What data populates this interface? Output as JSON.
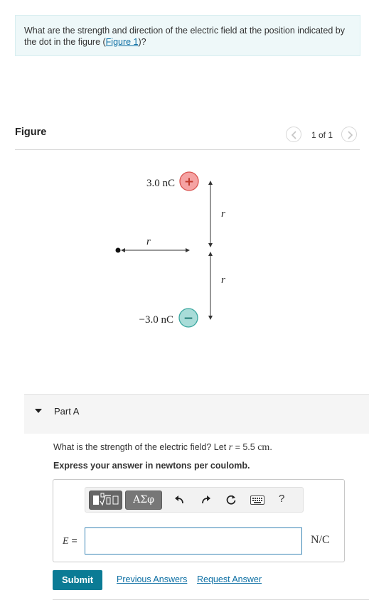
{
  "question": {
    "text_before": "What are the strength and direction of the electric field at the position indicated by the dot in the figure (",
    "link": "Figure 1",
    "text_after": ")?"
  },
  "figure": {
    "title": "Figure",
    "counter": "1 of 1",
    "diagram": {
      "positive_charge_label": "3.0 nC",
      "positive_symbol": "+",
      "negative_charge_label": "−3.0 nC",
      "negative_symbol": "−",
      "distance_symbol": "r"
    }
  },
  "part_a": {
    "label": "Part A",
    "prompt_before": "What is the strength of the electric field? Let ",
    "prompt_var": "r",
    "prompt_after": " = 5.5 ",
    "prompt_unit": "cm",
    "prompt_end": ".",
    "instruction": "Express your answer in newtons per coulomb.",
    "toolbar": {
      "greek_label": "ΑΣφ",
      "help_label": "?"
    },
    "answer_var": "E",
    "answer_eq": " =",
    "answer_value": "",
    "unit": "N/C"
  },
  "actions": {
    "submit": "Submit",
    "previous_answers": "Previous Answers",
    "request_answer": "Request Answer"
  },
  "colors": {
    "positive_fill": "#f5a3a3",
    "positive_stroke": "#d9534f",
    "negative_fill": "#a8dcd8",
    "negative_stroke": "#3aa79f",
    "accent": "#0b7b95",
    "link": "#0b6ea3"
  }
}
